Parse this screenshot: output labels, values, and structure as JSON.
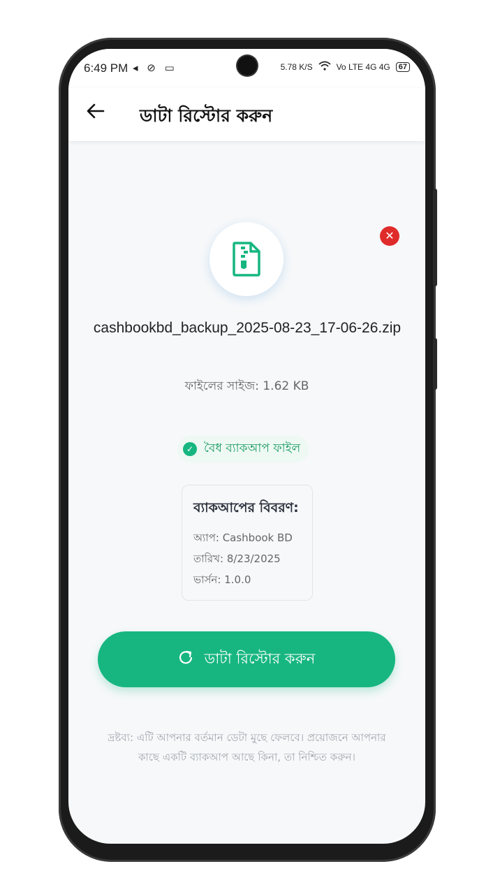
{
  "status_bar": {
    "time": "6:49 PM",
    "left_icons": "◂ ⊘ ▭",
    "net_speed": "5.78 K/S",
    "signals": "Vo LTE 4G 4G",
    "battery": "67"
  },
  "app_bar": {
    "back_icon": "arrow-left",
    "title": "ডাটা রিস্টোর করুন"
  },
  "file": {
    "name": "cashbookbd_backup_2025-08-23_17-06-26.zip",
    "size_label": "ফাইলের সাইজ: 1.62 KB",
    "icon": "zip-file-icon"
  },
  "validity": {
    "label": "বৈধ ব্যাকআপ ফাইল"
  },
  "details": {
    "title": "ব্যাকআপের বিবরণ:",
    "app": "অ্যাপ: Cashbook BD",
    "date": "তারিখ: 8/23/2025",
    "version": "ভার্সন: 1.0.0"
  },
  "restore_button": {
    "label": "ডাটা রিস্টোর করুন"
  },
  "note": "দ্রষ্টব্য: এটি আপনার বর্তমান ডেটা মুছে ফেলবে। প্রয়োজনে আপনার কাছে একটি ব্যাকআপ আছে কিনা, তা নিশ্চিত করুন।",
  "colors": {
    "accent": "#17b680",
    "danger": "#e02b2b",
    "background": "#f6f8fa"
  }
}
